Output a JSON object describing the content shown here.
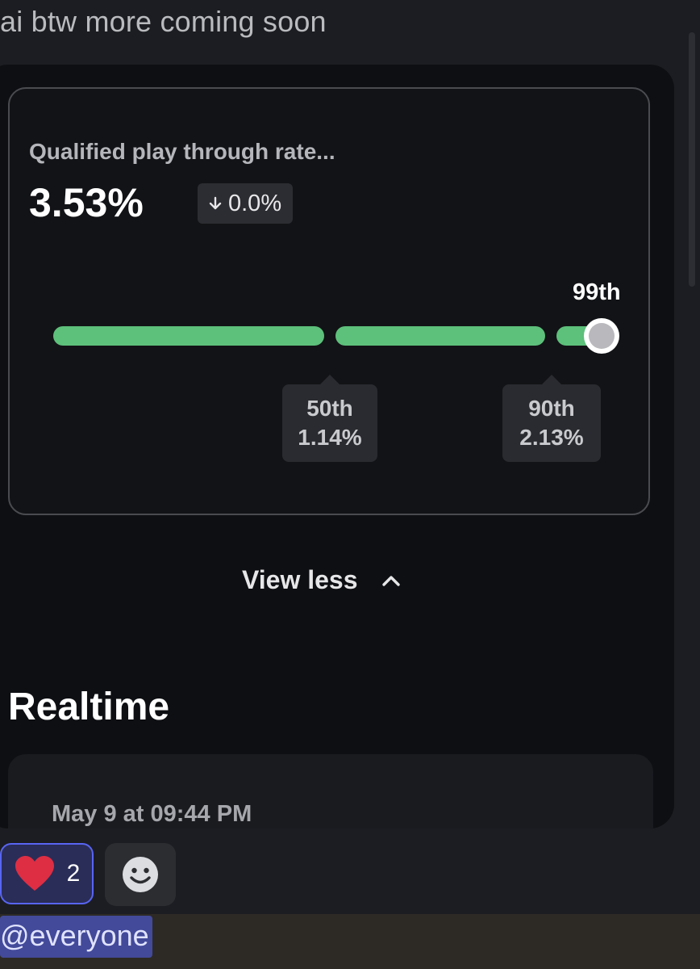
{
  "message": {
    "text": "ai btw more coming soon"
  },
  "metric": {
    "title": "Qualified play through rate...",
    "value": "3.53%",
    "delta": "0.0%",
    "delta_direction": "down",
    "current_percentile": "99th",
    "benchmarks": [
      {
        "percentile": "50th",
        "value": "1.14%"
      },
      {
        "percentile": "90th",
        "value": "2.13%"
      }
    ],
    "bar_color": "#5dc07b"
  },
  "view_less": {
    "label": "View less",
    "icon": "chevron-up-icon"
  },
  "realtime": {
    "title": "Realtime",
    "timestamp": "May 9 at 09:44 PM"
  },
  "reactions": {
    "heart": {
      "emoji": "heart-emoji",
      "count": "2",
      "color": "#dd2e44"
    },
    "add_icon": "smiley-add-reaction-icon"
  },
  "mention": {
    "text": "@everyone",
    "color": "#434a9a"
  },
  "colors": {
    "background": "#1c1d22",
    "embed": "#0e0f12",
    "accent": "#5865f2"
  }
}
